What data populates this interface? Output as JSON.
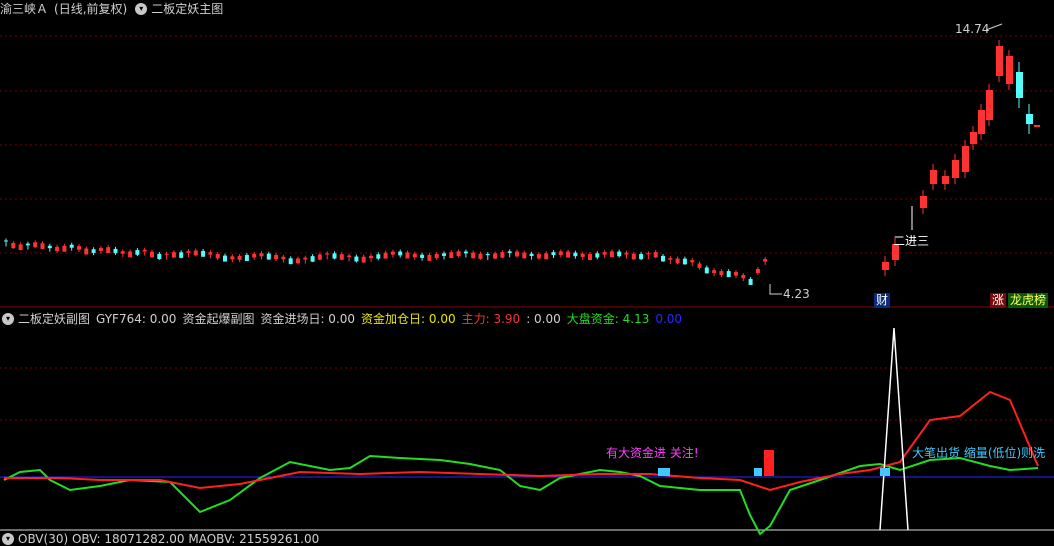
{
  "main_panel": {
    "stock_name": "渝三峡Ａ",
    "period_label": "(日线,前复权)",
    "indicator_name": "二板定妖主图",
    "high_label": "14.74",
    "low_label": "4.23",
    "signal_label": "二进三",
    "badges": {
      "cai": "财",
      "zhang": "涨",
      "longhu": "龙虎榜"
    },
    "candle_up_color": "#ff3232",
    "candle_down_color": "#54fcfc"
  },
  "sub_panel": {
    "indicator_name": "二板定妖副图",
    "values": [
      {
        "label": "GYF764: 0.00",
        "color": "#d0d0d0"
      },
      {
        "label": "资金起爆副图",
        "color": "#d0d0d0"
      },
      {
        "label": "资金进场日: 0.00",
        "color": "#d0d0d0"
      },
      {
        "label": "资金加仓日: 0.00",
        "color": "#e8e800"
      },
      {
        "label": "主力: 3.90",
        "color": "#ff3232"
      },
      {
        "label": ": 0.00",
        "color": "#d0d0d0"
      },
      {
        "label": "大盘资金: 4.13",
        "color": "#22dd22"
      },
      {
        "label": "0.00",
        "color": "#2828ff"
      }
    ],
    "annotation_attention": "有大资金进 关注!",
    "annotation_wash": "大笔出货 缩量(低位)则洗",
    "main_force_color": "#ff2020",
    "market_fund_color": "#22dd22"
  },
  "bottom_panel": {
    "text": "OBV(30)  OBV: 18071282.00  MAOBV: 21559261.00"
  }
}
